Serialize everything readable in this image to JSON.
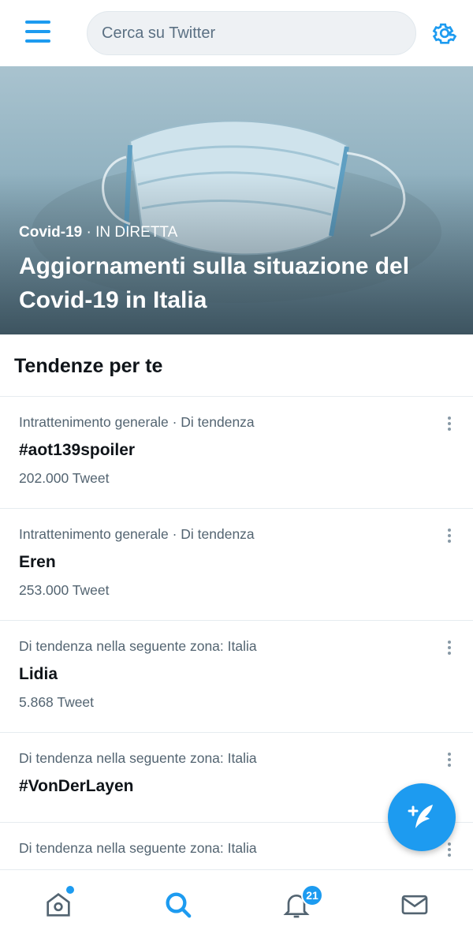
{
  "header": {
    "search_placeholder": "Cerca su Twitter"
  },
  "hero": {
    "topic": "Covid-19",
    "separator": " · ",
    "live_label": "IN DIRETTA",
    "title": "Aggiornamenti sulla situazione del Covid-19 in Italia"
  },
  "trends": {
    "section_title": "Tendenze per te",
    "items": [
      {
        "context": "Intrattenimento generale · Di tendenza",
        "name": "#aot139spoiler",
        "count": "202.000 Tweet"
      },
      {
        "context": "Intrattenimento generale · Di tendenza",
        "name": "Eren",
        "count": "253.000 Tweet"
      },
      {
        "context": "Di tendenza nella seguente zona: Italia",
        "name": "Lidia",
        "count": "5.868 Tweet"
      },
      {
        "context": "Di tendenza nella seguente zona: Italia",
        "name": "#VonDerLayen",
        "count": ""
      },
      {
        "context": "Di tendenza nella seguente zona: Italia",
        "name": "",
        "count": ""
      }
    ]
  },
  "bottom_nav": {
    "notifications_badge": "21",
    "active_tab": "search"
  },
  "icons": {
    "menu": "menu-icon",
    "settings": "gear-icon",
    "home": "home-icon",
    "search": "search-icon",
    "notifications": "bell-icon",
    "messages": "mail-icon",
    "compose": "compose-tweet-icon",
    "more": "more-vertical-icon"
  },
  "colors": {
    "accent": "#1d9bf0",
    "text_primary": "#0f1419",
    "text_secondary": "#536471"
  }
}
